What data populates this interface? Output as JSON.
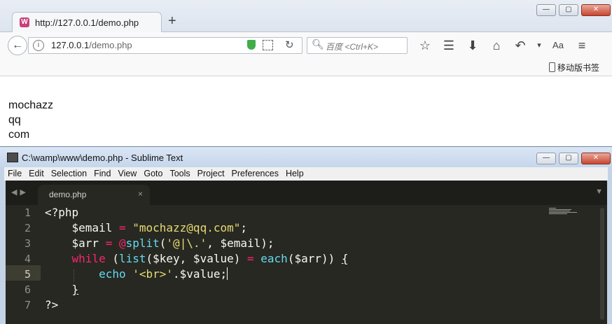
{
  "browser": {
    "tab": {
      "title": "http://127.0.0.1/demo.php",
      "favicon": "wamp-icon"
    },
    "newtab_glyph": "+",
    "window_controls": [
      "—",
      "▢",
      "✕"
    ],
    "url": {
      "host": "127.0.0.1",
      "path": "/demo.php"
    },
    "search_placeholder": "百度 <Ctrl+K>",
    "toolbar_icons": [
      "star-icon",
      "reader-list-icon",
      "download-icon",
      "home-icon",
      "undo-icon",
      "dropdown-icon",
      "reader-mode-icon",
      "menu-icon"
    ],
    "bookmarks_mobile": "移动版书签",
    "page_lines": [
      "mochazz",
      "qq",
      "com"
    ]
  },
  "editor": {
    "window_title": "C:\\wamp\\www\\demo.php - Sublime Text",
    "menu": [
      "File",
      "Edit",
      "Selection",
      "Find",
      "View",
      "Goto",
      "Tools",
      "Project",
      "Preferences",
      "Help"
    ],
    "tab": {
      "label": "demo.php",
      "close": "×"
    },
    "line_numbers": [
      "1",
      "2",
      "3",
      "4",
      "5",
      "6",
      "7"
    ],
    "active_line": 5,
    "code": {
      "l1": "<?php",
      "l2_var": "$email",
      "l2_op": " = ",
      "l2_str": "\"mochazz@qq.com\"",
      "l2_end": ";",
      "l3_var": "$arr",
      "l3_op": " = ",
      "l3_at": "@",
      "l3_fn": "split",
      "l3_p1": "(",
      "l3_str": "'@|\\.'",
      "l3_rest": ", $email);",
      "l4_kw": "while",
      "l4_a": " (",
      "l4_fn": "list",
      "l4_b": "($key, $value) ",
      "l4_op": "=",
      "l4_c": " ",
      "l4_fn2": "each",
      "l4_d": "($arr)) ",
      "l4_brace": "{",
      "l5_fn": "echo",
      "l5_a": " ",
      "l5_str": "'<br>'",
      "l5_b": ".$value;",
      "l6": "}",
      "l7": "?>"
    },
    "colors": {
      "keyword": "#f92672",
      "string": "#e6db74",
      "function": "#66d9ef",
      "background": "#272822"
    }
  }
}
